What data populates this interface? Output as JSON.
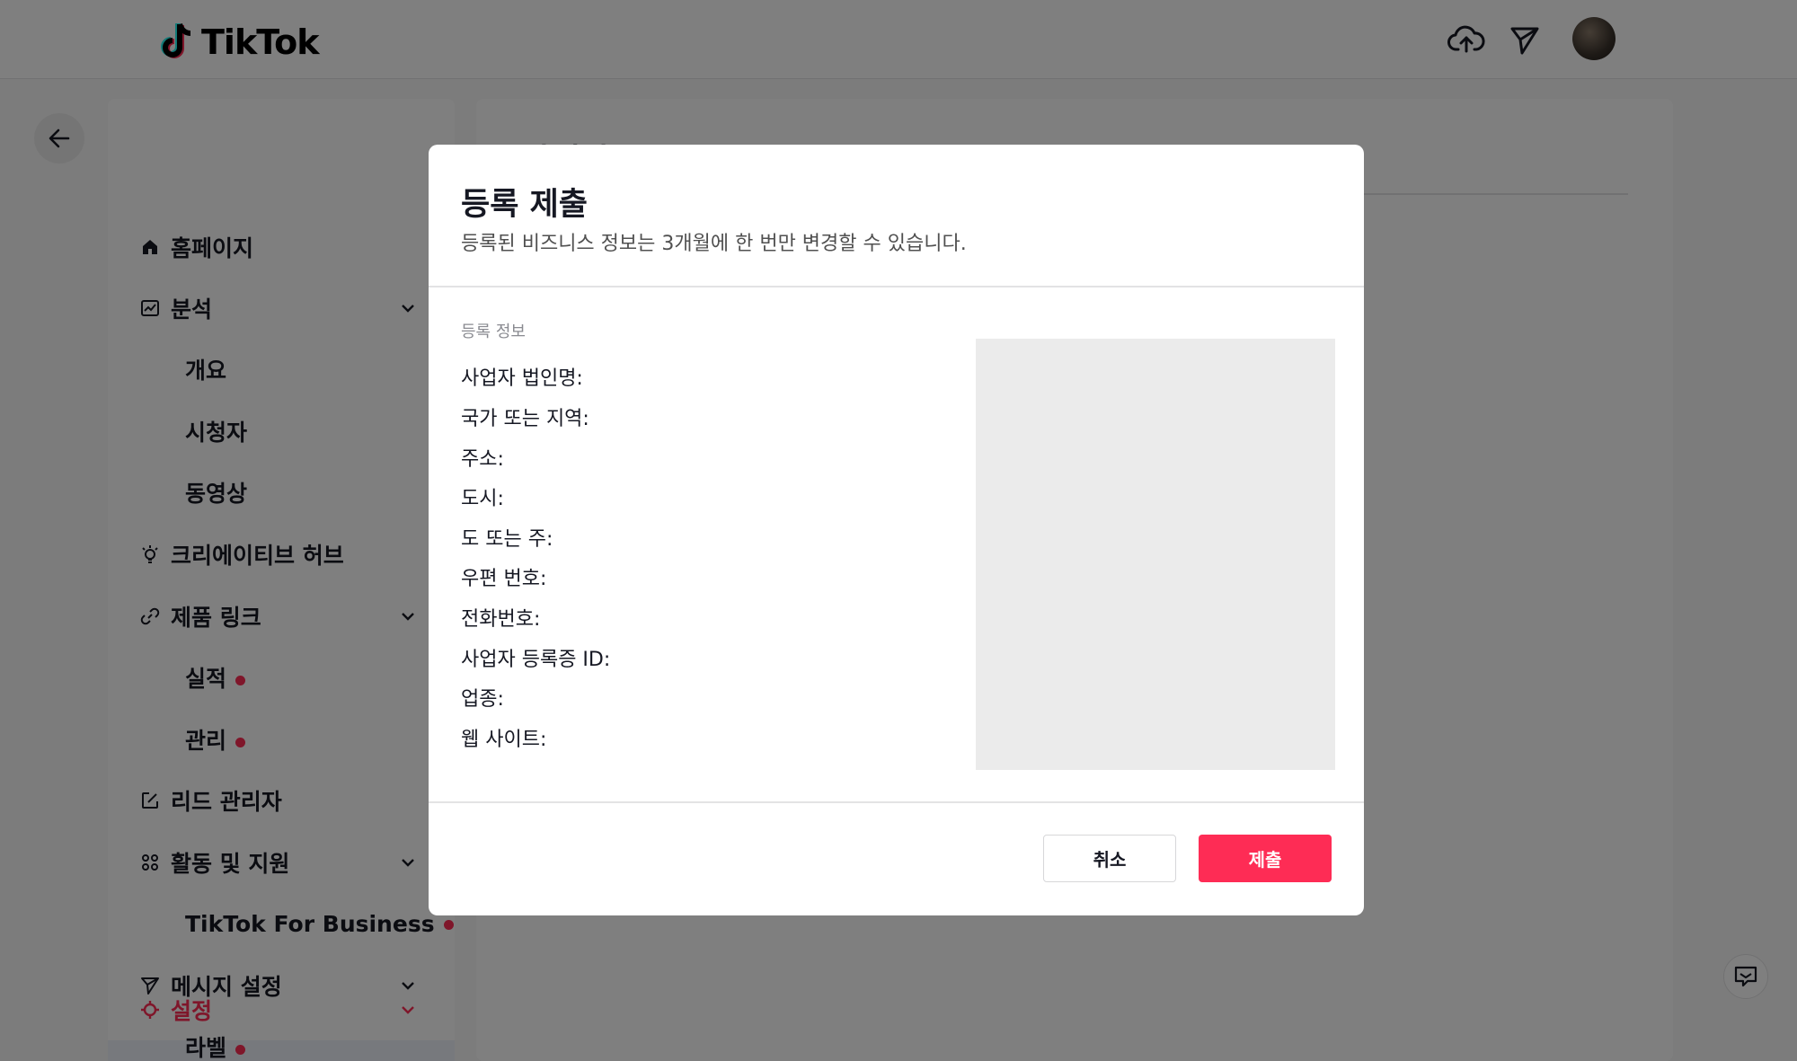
{
  "app": {
    "brand": "TikTok"
  },
  "header": {
    "upload_icon": "cloud-upload-icon",
    "inbox_icon": "paper-plane-icon",
    "avatar_icon": "avatar"
  },
  "main": {
    "title": "사업자 등록"
  },
  "sidebar": {
    "items": [
      {
        "label": "홈페이지",
        "icon": "home-icon"
      },
      {
        "label": "분석",
        "icon": "analytics-icon",
        "expandable": true
      },
      {
        "label": "개요",
        "sub": true
      },
      {
        "label": "시청자",
        "sub": true
      },
      {
        "label": "동영상",
        "sub": true
      },
      {
        "label": "크리에이티브 허브",
        "icon": "bulb-icon"
      },
      {
        "label": "제품 링크",
        "icon": "link-icon",
        "expandable": true
      },
      {
        "label": "실적",
        "sub": true,
        "dot": true
      },
      {
        "label": "관리",
        "sub": true,
        "dot": true
      },
      {
        "label": "리드 관리자",
        "icon": "edit-icon"
      },
      {
        "label": "활동 및 지원",
        "icon": "grid-icon",
        "expandable": true
      },
      {
        "label": "TikTok For Business",
        "sub": true,
        "dot": true
      },
      {
        "label": "메시지 설정",
        "icon": "send-icon",
        "expandable": true
      },
      {
        "label": "라벨",
        "sub": true,
        "dot": true
      },
      {
        "label": "설정",
        "icon": "gear-icon",
        "expandable": true,
        "active": true
      }
    ]
  },
  "modal": {
    "title": "등록 제출",
    "description": "등록된 비즈니스 정보는 3개월에 한 번만 변경할 수 있습니다.",
    "section_label": "등록 정보",
    "fields": [
      "사업자 법인명:",
      "국가 또는 지역:",
      "주소:",
      "도시:",
      "도 또는 주:",
      "우편 번호:",
      "전화번호:",
      "사업자 등록증 ID:",
      "업종:",
      "웹 사이트:"
    ],
    "cancel_label": "취소",
    "submit_label": "제출"
  },
  "colors": {
    "accent": "#fe2c55",
    "overlay": "rgba(0,0,0,0.5)",
    "preview_bg": "#ebebeb"
  }
}
